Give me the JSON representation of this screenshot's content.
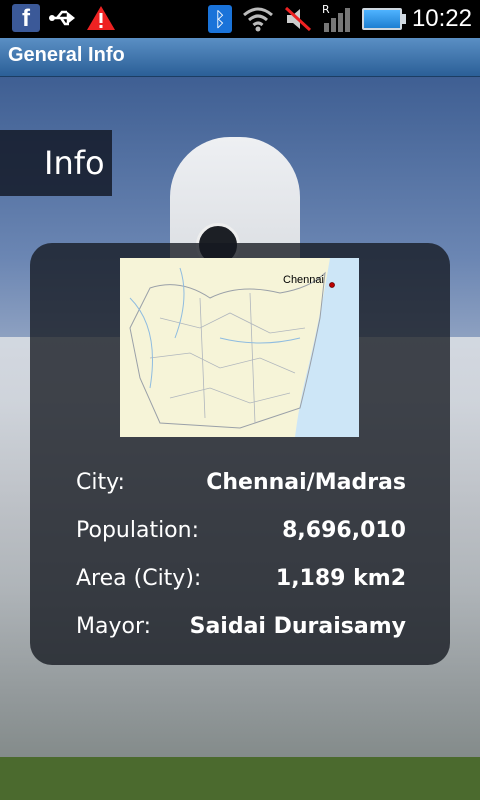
{
  "status_bar": {
    "icons_left": [
      "facebook-icon",
      "usb-icon",
      "warning-icon"
    ],
    "icons_right": [
      "bluetooth-icon",
      "wifi-icon",
      "mute-icon",
      "signal-icon",
      "battery-icon"
    ],
    "roaming_indicator": "R",
    "time": "10:22"
  },
  "title_bar": {
    "title": "General Info"
  },
  "tab": {
    "label": "Info"
  },
  "map": {
    "label": "Chennai"
  },
  "info": {
    "rows": [
      {
        "label": "City:",
        "value": "Chennai/Madras"
      },
      {
        "label": "Population:",
        "value": "8,696,010"
      },
      {
        "label": "Area (City):",
        "value": "1,189 km2"
      },
      {
        "label": "Mayor:",
        "value": "Saidai Duraisamy"
      }
    ]
  },
  "colors": {
    "title_bar": "#3f73ab",
    "panel": "#14182099",
    "facebook": "#3b5998",
    "bluetooth": "#1a73d9",
    "map_land": "#f6f4d8",
    "map_sea": "#cde6f7"
  }
}
